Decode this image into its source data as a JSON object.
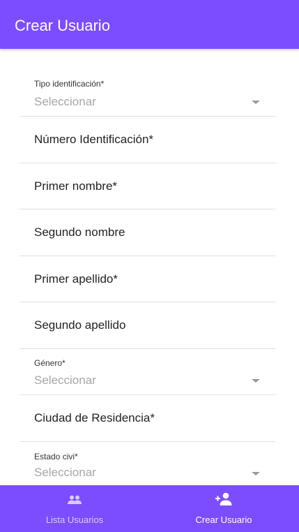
{
  "header": {
    "title": "Crear Usuario"
  },
  "form": {
    "tipo_identificacion": {
      "label": "Tipo identificación*",
      "value": "Seleccionar"
    },
    "numero_identificacion": {
      "placeholder": "Número Identificación*"
    },
    "primer_nombre": {
      "placeholder": "Primer nombre*"
    },
    "segundo_nombre": {
      "placeholder": "Segundo nombre"
    },
    "primer_apellido": {
      "placeholder": "Primer apellido*"
    },
    "segundo_apellido": {
      "placeholder": "Segundo apellido"
    },
    "genero": {
      "label": "Género*",
      "value": "Seleccionar"
    },
    "ciudad_residencia": {
      "placeholder": "Ciudad de Residencia*"
    },
    "estado_civil": {
      "label": "Estado civi*",
      "value": "Seleccionar"
    }
  },
  "tabbar": {
    "tabs": [
      {
        "label": "Lista Usuarios",
        "icon": "people-icon",
        "active": false
      },
      {
        "label": "Crear Usuario",
        "icon": "person-add-icon",
        "active": true
      }
    ]
  },
  "colors": {
    "primary": "#7c4dff",
    "divider": "#e2e2e2",
    "placeholder_select": "#a6a6a6"
  }
}
